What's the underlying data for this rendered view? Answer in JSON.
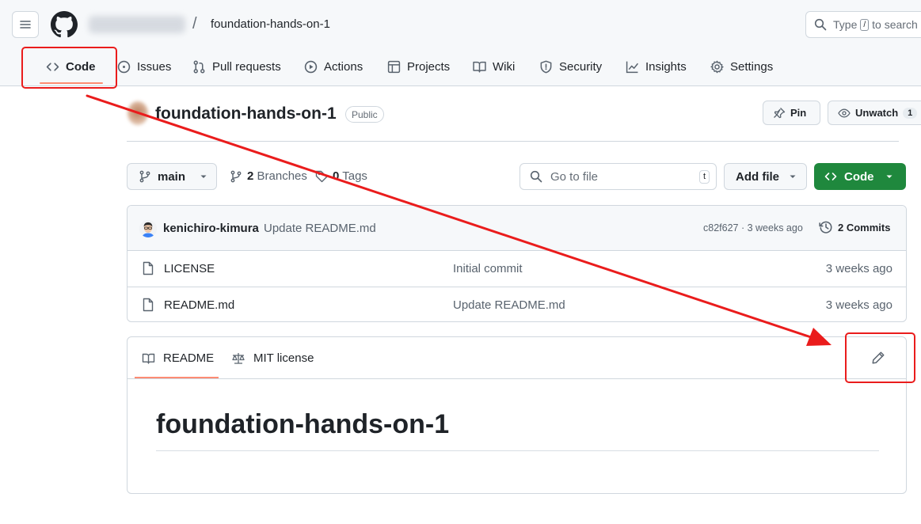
{
  "header": {
    "repo_name": "foundation-hands-on-1",
    "breadcrumb_sep": "/",
    "search": {
      "before": "Type",
      "key": "/",
      "after": "to search"
    }
  },
  "tabs": [
    {
      "label": "Code",
      "icon": "code-icon"
    },
    {
      "label": "Issues",
      "icon": "issue-icon"
    },
    {
      "label": "Pull requests",
      "icon": "pull-request-icon"
    },
    {
      "label": "Actions",
      "icon": "play-icon"
    },
    {
      "label": "Projects",
      "icon": "table-icon"
    },
    {
      "label": "Wiki",
      "icon": "book-icon"
    },
    {
      "label": "Security",
      "icon": "shield-icon"
    },
    {
      "label": "Insights",
      "icon": "graph-icon"
    },
    {
      "label": "Settings",
      "icon": "gear-icon"
    }
  ],
  "repo": {
    "title": "foundation-hands-on-1",
    "visibility": "Public",
    "pin_label": "Pin",
    "watch_label": "Unwatch",
    "watch_count": "1"
  },
  "toolbar": {
    "branch": "main",
    "branches_count": "2",
    "branches_label": "Branches",
    "tags_count": "0",
    "tags_label": "Tags",
    "goto_placeholder": "Go to file",
    "goto_key": "t",
    "add_file_label": "Add file",
    "code_label": "Code"
  },
  "latest_commit": {
    "author": "kenichiro-kimura",
    "message": "Update README.md",
    "sha_time": "c82f627 · 3 weeks ago",
    "commits_label": "2 Commits"
  },
  "files": [
    {
      "name": "LICENSE",
      "message": "Initial commit",
      "date": "3 weeks ago"
    },
    {
      "name": "README.md",
      "message": "Update README.md",
      "date": "3 weeks ago"
    }
  ],
  "readme": {
    "tab_readme": "README",
    "tab_license": "MIT license",
    "heading": "foundation-hands-on-1"
  },
  "colors": {
    "accent_underline": "#fd8c73",
    "primary_green": "#1f883d",
    "annotation_red": "#ea1c1c"
  }
}
